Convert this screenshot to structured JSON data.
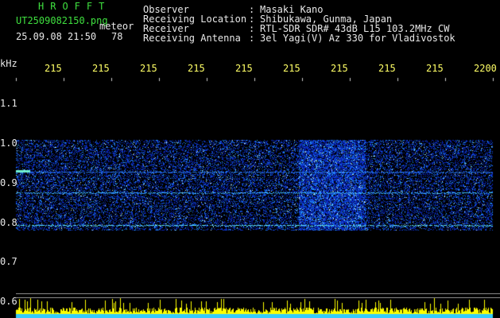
{
  "header": {
    "title": "HROFFT",
    "filename": "UT2509082150.png",
    "meteor_label": "meteor",
    "datetime": "25.09.08 21:50",
    "count": "78",
    "fields": [
      {
        "label": "Observer",
        "value": "Masaki Kano"
      },
      {
        "label": "Receiving Location",
        "value": "Shibukawa, Gunma, Japan"
      },
      {
        "label": "Receiver",
        "value": "RTL-SDR SDR# 43dB L15 103.2MHz CW"
      },
      {
        "label": "Receiving Antenna",
        "value": "3el Yagi(V) Az 330 for Vladivostok"
      }
    ]
  },
  "time_axis": {
    "labels": [
      "215",
      "215",
      "215",
      "215",
      "215",
      "215",
      "215",
      "215",
      "215",
      "2200"
    ]
  },
  "freq_axis": {
    "unit": "kHz",
    "labels": [
      "1.1",
      "1.0",
      "0.9",
      "0.8",
      "0.7",
      "0.6"
    ]
  },
  "colors": {
    "title": "#3fe03f",
    "text": "#e8e8e8",
    "axis": "#ffff66",
    "spectrum_base": "#0a1a9a",
    "signal": "#33ccff",
    "level_bars": "#ffff00"
  }
}
